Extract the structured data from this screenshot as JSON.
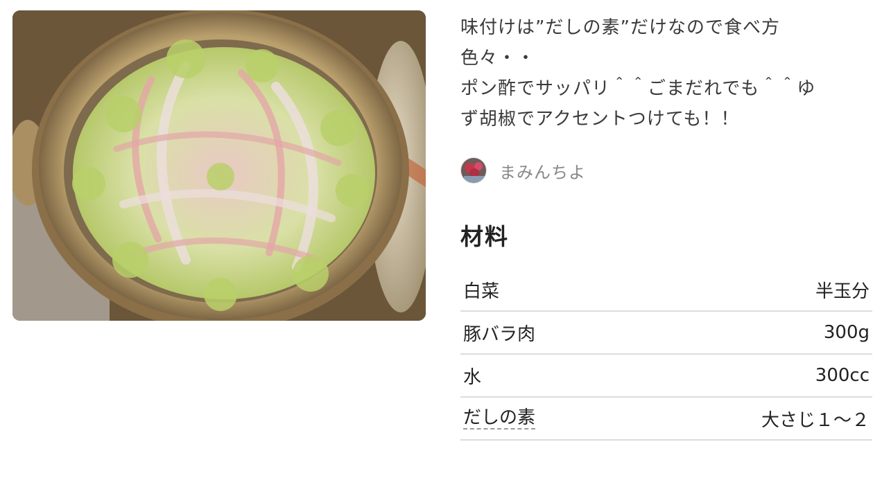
{
  "recipe": {
    "photo_alt": "dish-photo",
    "description": "味付けは”だしの素”だけなので食べ方\n色々・・\nポン酢でサッパリ＾＾ごまだれでも＾＾ゆ\nず胡椒でアクセントつけても！！",
    "author": {
      "name": "まみんちよ",
      "avatar_icon": "user-avatar-icon"
    }
  },
  "ingredients": {
    "title": "材料",
    "items": [
      {
        "name": "白菜",
        "amount": "半玉分",
        "linked": false
      },
      {
        "name": "豚バラ肉",
        "amount": "300g",
        "linked": false
      },
      {
        "name": "水",
        "amount": "300cc",
        "linked": false
      },
      {
        "name": "だしの素",
        "amount": "大さじ１〜２",
        "linked": true
      }
    ]
  },
  "colors": {
    "text": "#3a3a3a",
    "muted": "#888888",
    "divider": "#dcdcdc",
    "pot": "#c9b48a",
    "cabbage": "#c8d98a",
    "pork": "#e8b7b5"
  }
}
